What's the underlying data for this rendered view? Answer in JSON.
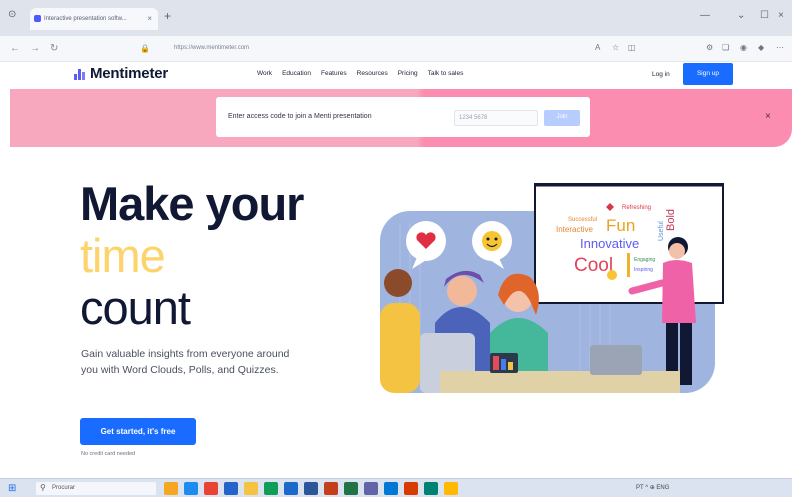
{
  "browser": {
    "tab_title": "Interactive presentation softw...",
    "url": "https://www.mentimeter.com"
  },
  "header": {
    "logo_text": "Mentimeter",
    "nav": [
      "Work",
      "Education",
      "Features",
      "Resources",
      "Pricing",
      "Talk to sales"
    ],
    "login": "Log in",
    "signup": "Sign up"
  },
  "banner": {
    "label": "Enter access code to join a Menti presentation",
    "placeholder": "1234 5678",
    "join": "Join",
    "close": "×"
  },
  "hero": {
    "line1": "Make your",
    "line2": "time",
    "line3": "count",
    "subtext": "Gain valuable insights from everyone around you with Word Clouds, Polls, and Quizzes.",
    "cta": "Get started, it's free",
    "cta_note": "No credit card needed"
  },
  "wordcloud": [
    "Refreshing",
    "Successful",
    "Interactive",
    "Fun",
    "Innovative",
    "Useful",
    "Bold",
    "Cool",
    "Engaging",
    "Inspiring"
  ],
  "taskbar": {
    "search": "Procurar",
    "tray": "PT  ^  ⊕ ENG"
  },
  "colors": {
    "accent": "#196cff",
    "banner": "#f7a8be",
    "hero_highlight": "#fdd36b",
    "illustration_bg": "#9fb5df"
  }
}
